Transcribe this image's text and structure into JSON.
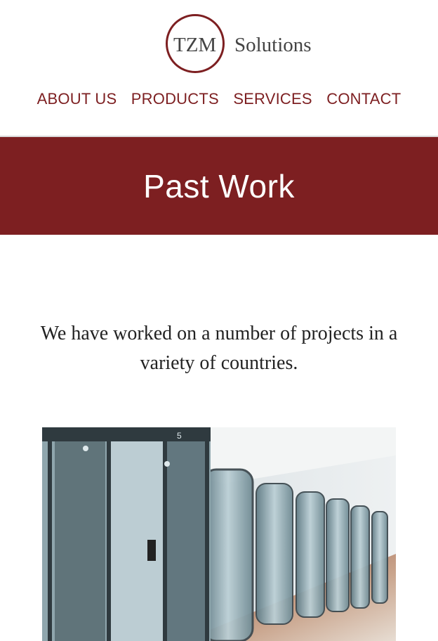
{
  "logo": {
    "mark": "TZM",
    "wordmark": "Solutions"
  },
  "nav": [
    "ABOUT US",
    "PRODUCTS",
    "SERVICES",
    "CONTACT"
  ],
  "banner": {
    "title": "Past Work"
  },
  "intro": {
    "text": "We have worked on a number of projects in a variety of countries."
  },
  "photo": {
    "sign": "5"
  },
  "colors": {
    "brand": "#7d1f21",
    "text": "#222222",
    "background": "#ffffff"
  }
}
